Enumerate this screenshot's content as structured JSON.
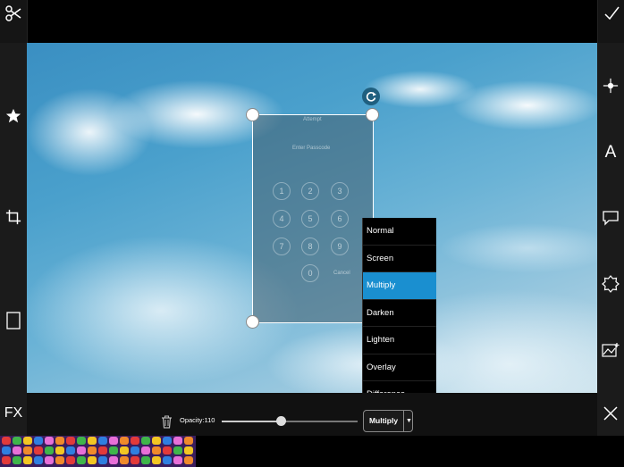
{
  "top_toolbar": {
    "scissors_icon": "scissors-icon",
    "confirm_icon": "checkmark-icon"
  },
  "left_toolbar": {
    "items": [
      {
        "icon": "star-icon"
      },
      {
        "icon": "crop-icon"
      },
      {
        "icon": "rectangle-icon"
      }
    ]
  },
  "right_toolbar": {
    "items": [
      {
        "icon": "sparkle-icon"
      },
      {
        "icon": "text-icon",
        "glyph": "A"
      },
      {
        "icon": "speech-bubble-icon"
      },
      {
        "icon": "sticker-badge-icon"
      },
      {
        "icon": "image-add-icon"
      }
    ]
  },
  "layer": {
    "ghost_text": {
      "status": "Attempt",
      "prompt": "Enter Passcode",
      "keys": [
        "1",
        "2",
        "3",
        "4",
        "5",
        "6",
        "7",
        "8",
        "9",
        "0"
      ],
      "cancel": "Cancel"
    }
  },
  "blend_menu": {
    "options": [
      "Normal",
      "Screen",
      "Multiply",
      "Darken",
      "Lighten",
      "Overlay",
      "Difference"
    ],
    "selected": "Multiply"
  },
  "bottom_bar": {
    "fx_label": "FX",
    "opacity_label": "Opacity:110",
    "opacity_value": 110,
    "opacity_max": 255,
    "blend_select_label": "Multiply",
    "blend_select_arrow": "▼",
    "delete_icon": "trash-icon",
    "close_icon": "close-icon"
  },
  "colors": {
    "accent": "#1a8fd0",
    "toolbar_bg": "#1b1b1b"
  }
}
